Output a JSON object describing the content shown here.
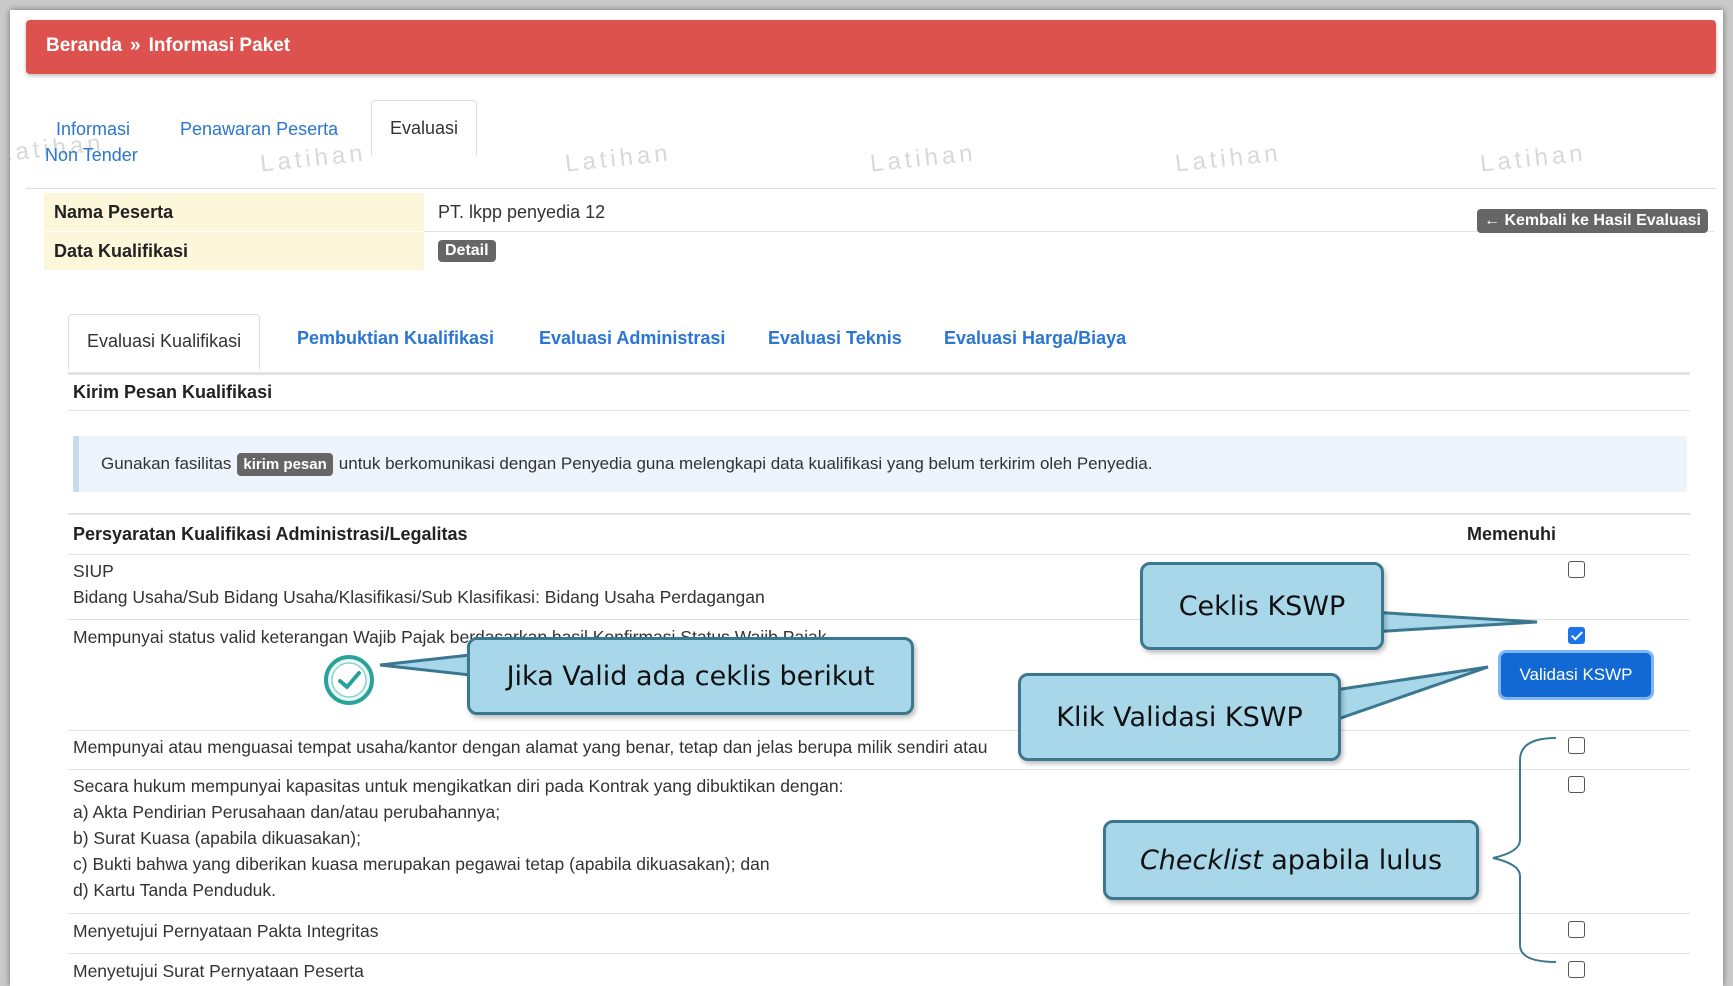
{
  "breadcrumb": {
    "home": "Beranda",
    "separator": "»",
    "current": "Informasi Paket"
  },
  "watermark": "Latihan",
  "top_tabs": [
    {
      "label_line1": "Informasi",
      "label_line2": "Non Tender"
    },
    {
      "label": "Penawaran Peserta"
    },
    {
      "label": "Evaluasi",
      "active": true
    }
  ],
  "peserta": {
    "nama_label": "Nama Peserta",
    "nama_value": "PT. lkpp penyedia 12",
    "kualifikasi_label": "Data Kualifikasi",
    "detail_badge": "Detail",
    "back_button": "Kembali ke Hasil Evaluasi"
  },
  "eval_tabs": [
    {
      "label": "Evaluasi Kualifikasi",
      "active": true
    },
    {
      "label": "Pembuktian Kualifikasi"
    },
    {
      "label": "Evaluasi Administrasi"
    },
    {
      "label": "Evaluasi Teknis"
    },
    {
      "label": "Evaluasi Harga/Biaya"
    }
  ],
  "section_title": "Kirim Pesan Kualifikasi",
  "info": {
    "prefix": "Gunakan fasilitas",
    "badge": "kirim pesan",
    "suffix": "untuk berkomunikasi dengan Penyedia guna melengkapi data kualifikasi yang belum terkirim oleh Penyedia."
  },
  "table": {
    "col_requirement": "Persyaratan Kualifikasi Administrasi/Legalitas",
    "col_fulfilled": "Memenuhi",
    "rows": [
      {
        "line1": "SIUP",
        "line2": "Bidang Usaha/Sub Bidang Usaha/Klasifikasi/Sub Klasifikasi: Bidang Usaha Perdagangan",
        "checked": false
      },
      {
        "line1": "Mempunyai status valid keterangan Wajib Pajak berdasarkan hasil Konfirmasi Status Wajib Pajak.",
        "checked": true,
        "button": "Validasi KSWP"
      },
      {
        "line1": "Mempunyai atau menguasai tempat usaha/kantor dengan alamat yang benar, tetap dan jelas berupa milik sendiri atau",
        "checked": false
      },
      {
        "line1": "Secara hukum mempunyai kapasitas untuk mengikatkan diri pada Kontrak yang dibuktikan dengan:",
        "line2": "a) Akta Pendirian Perusahaan dan/atau perubahannya;",
        "line3": "b) Surat Kuasa (apabila dikuasakan);",
        "line4": "c) Bukti bahwa yang diberikan kuasa merupakan pegawai tetap (apabila dikuasakan); dan",
        "line5": "d) Kartu Tanda Penduduk.",
        "checked": false
      },
      {
        "line1": "Menyetujui Pernyataan Pakta Integritas",
        "checked": false
      },
      {
        "line1": "Menyetujui Surat Pernyataan Peserta",
        "checked": false
      }
    ]
  },
  "callouts": {
    "ceklis": "Ceklis KSWP",
    "valid": "Jika Valid ada ceklis berikut",
    "klik": "Klik Validasi KSWP",
    "checklist_italic": "Checklist",
    "checklist_rest": " apabila lulus"
  },
  "colors": {
    "header": "#dd524f",
    "link": "#2a76d2",
    "callout_fill": "#a8d7ea",
    "callout_border": "#3c7790",
    "button": "#1269d3"
  }
}
